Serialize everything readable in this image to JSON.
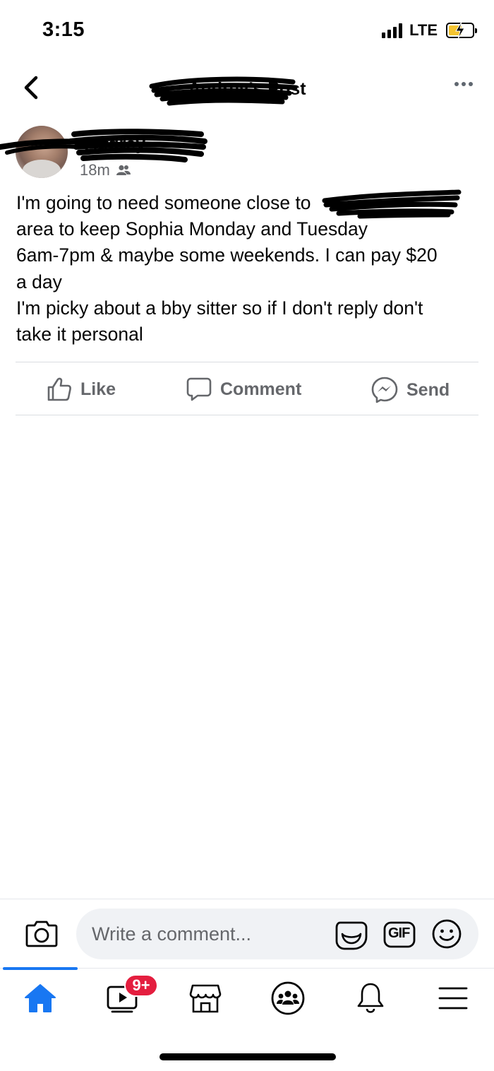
{
  "status_bar": {
    "time": "3:15",
    "network": "LTE"
  },
  "header": {
    "title": "Audrey's Post"
  },
  "post": {
    "author": "Audrey",
    "time_ago": "18m",
    "body_lines": [
      "I'm going to need someone close to",
      "area to keep Sophia Monday and Tuesday",
      "6am-7pm & maybe some weekends. I can pay $20",
      "a day",
      "I'm picky about a bby sitter so if I don't reply don't",
      "take it personal"
    ]
  },
  "actions": {
    "like": "Like",
    "comment": "Comment",
    "send": "Send"
  },
  "comment_bar": {
    "placeholder": "Write a comment...",
    "gif_label": "GIF"
  },
  "tab_bar": {
    "items": [
      "home",
      "watch",
      "marketplace",
      "groups",
      "notifications",
      "menu"
    ],
    "watch_badge": "9+"
  },
  "colors": {
    "accent": "#1877f2",
    "badge": "#e41e3f",
    "secondary_text": "#65676b"
  }
}
